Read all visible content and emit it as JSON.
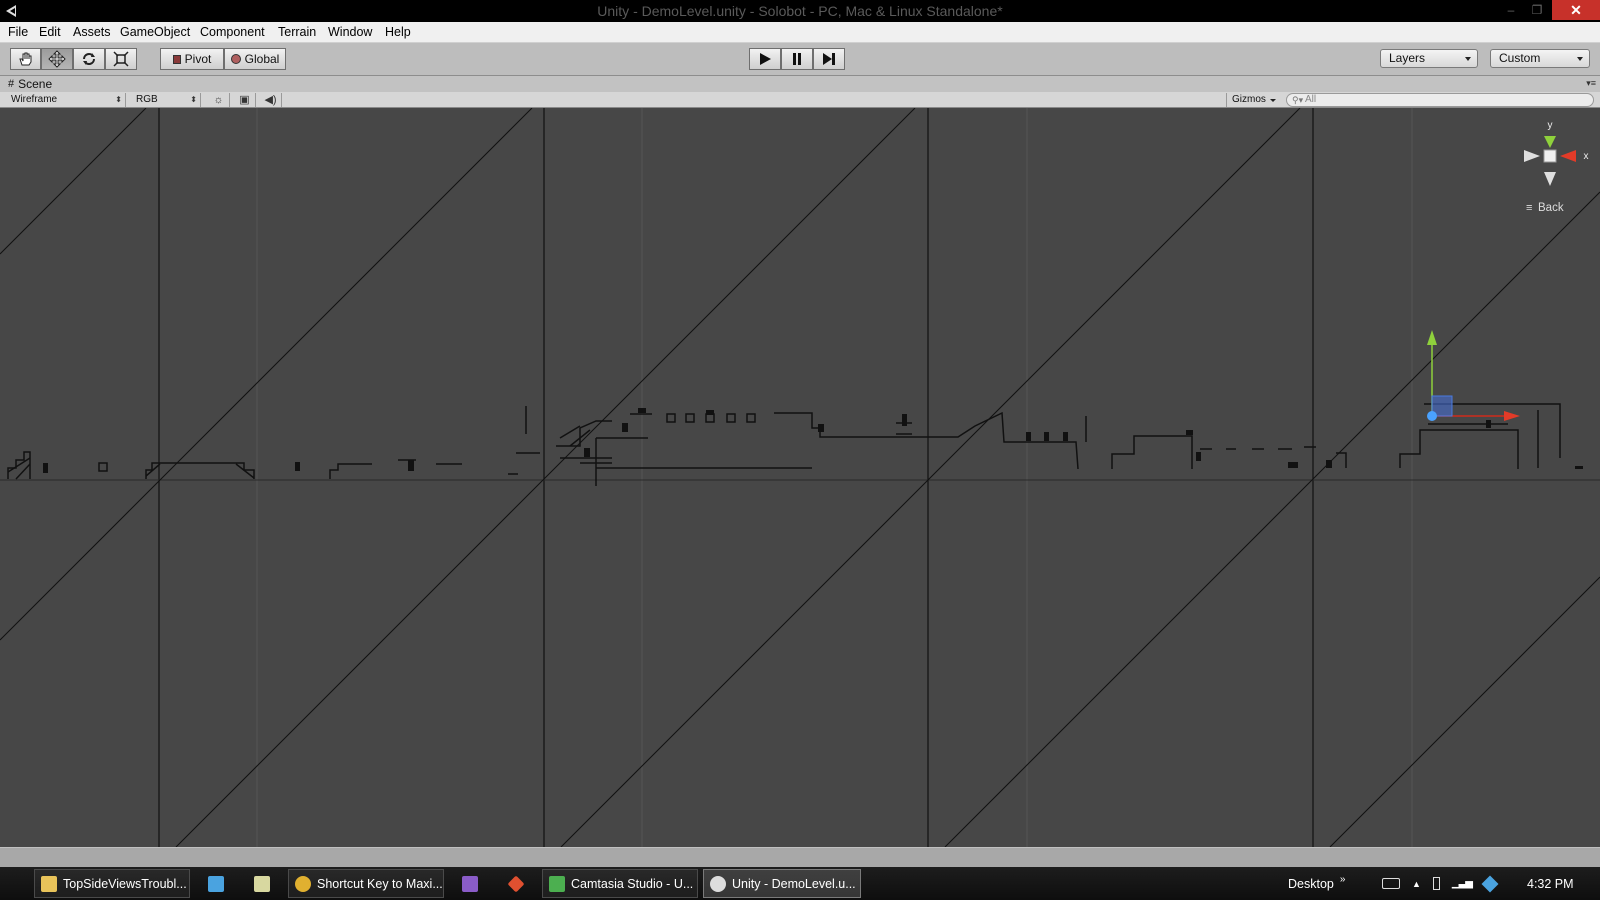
{
  "window": {
    "title": "Unity - DemoLevel.unity - Solobot - PC, Mac & Linux Standalone*",
    "minimize": "–",
    "maximize": "❐",
    "close": "✕"
  },
  "menu": [
    "File",
    "Edit",
    "Assets",
    "GameObject",
    "Component",
    "Terrain",
    "Window",
    "Help"
  ],
  "toolbar": {
    "tools": [
      "hand-icon",
      "move-icon",
      "rotate-icon",
      "scale-icon"
    ],
    "pivot_label": "Pivot",
    "global_label": "Global",
    "layers_label": "Layers",
    "layout_label": "Custom"
  },
  "scene": {
    "tab_label": "Scene",
    "render_mode": "Wireframe",
    "color_mode": "RGB",
    "gizmos_label": "Gizmos",
    "search_placeholder": "All",
    "view_label": "Back",
    "axis_y": "y",
    "axis_x": "x"
  },
  "taskbar": {
    "items": [
      {
        "label": "TopSideViewsTroubl...",
        "icon": "folder-icon",
        "color": "#e8c35a"
      },
      {
        "label": "",
        "icon": "dropbox-icon",
        "color": "#4aa3e0"
      },
      {
        "label": "",
        "icon": "notepad-icon",
        "color": "#d8d8a0"
      },
      {
        "label": "Shortcut Key to Maxi...",
        "icon": "chrome-icon",
        "color": "#e0b030"
      },
      {
        "label": "",
        "icon": "visual-studio-icon",
        "color": "#8a5cc8"
      },
      {
        "label": "",
        "icon": "git-icon",
        "color": "#e05030"
      },
      {
        "label": "Camtasia Studio - U...",
        "icon": "camtasia-icon",
        "color": "#4caf50"
      },
      {
        "label": "Unity - DemoLevel.u...",
        "icon": "unity-icon",
        "color": "#dddddd"
      }
    ],
    "desktop_label": "Desktop",
    "clock": "4:32 PM"
  }
}
